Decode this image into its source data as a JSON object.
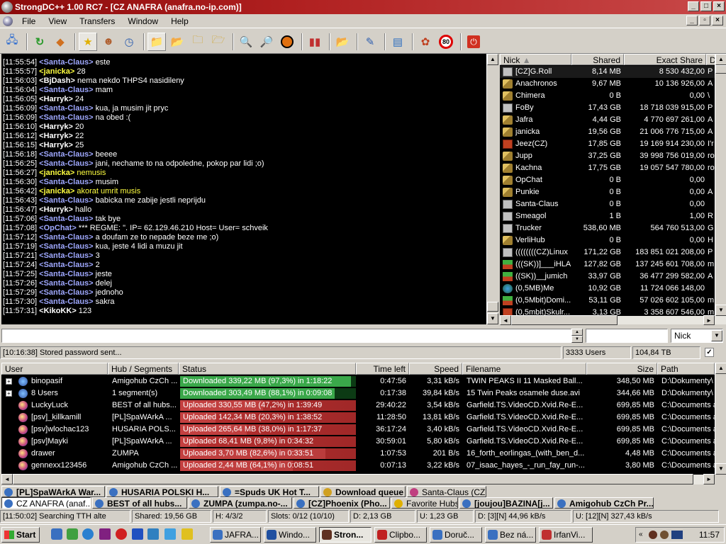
{
  "window": {
    "title": "StrongDC++ 1.00 RC7 - [CZ ANAFRA (anafra.no-ip.com)]"
  },
  "menu": [
    "File",
    "View",
    "Transfers",
    "Window",
    "Help"
  ],
  "colors": {
    "chat_bg": "#000000",
    "nick_blue": "#9fa8ff",
    "nick_white": "#ffffff",
    "nick_yellow": "#ffff40",
    "download_fill": "#3aa84a",
    "upload_fill": "#c83c3c"
  },
  "chat": [
    {
      "ts": "[11:55:54]",
      "nick": "<Santa-Claus>",
      "c": "b",
      "msg": " este"
    },
    {
      "ts": "[11:55:57]",
      "nick": "<janicka>",
      "c": "y",
      "msg": " 28"
    },
    {
      "ts": "[11:56:03]",
      "nick": "<BjDash>",
      "c": "w",
      "msg": " nema nekdo THPS4 nasidileny"
    },
    {
      "ts": "[11:56:04]",
      "nick": "<Santa-Claus>",
      "c": "b",
      "msg": " mam"
    },
    {
      "ts": "[11:56:05]",
      "nick": "<Harryk>",
      "c": "w",
      "msg": " 24"
    },
    {
      "ts": "[11:56:09]",
      "nick": "<Santa-Claus>",
      "c": "b",
      "msg": " kua, ja musim jit pryc"
    },
    {
      "ts": "[11:56:09]",
      "nick": "<Santa-Claus>",
      "c": "b",
      "msg": " na obed :("
    },
    {
      "ts": "[11:56:10]",
      "nick": "<Harryk>",
      "c": "w",
      "msg": " 20"
    },
    {
      "ts": "[11:56:12]",
      "nick": "<Harryk>",
      "c": "w",
      "msg": " 22"
    },
    {
      "ts": "[11:56:15]",
      "nick": "<Harryk>",
      "c": "w",
      "msg": " 25"
    },
    {
      "ts": "[11:56:18]",
      "nick": "<Santa-Claus>",
      "c": "b",
      "msg": " beeee"
    },
    {
      "ts": "[11:56:25]",
      "nick": "<Santa-Claus>",
      "c": "b",
      "msg": " jani, nechame to na odpoledne, pokop par lidi ;o)"
    },
    {
      "ts": "[11:56:27]",
      "nick": "<janicka>",
      "c": "y",
      "msg": " nemusis",
      "my": true
    },
    {
      "ts": "[11:56:30]",
      "nick": "<Santa-Claus>",
      "c": "b",
      "msg": " musim"
    },
    {
      "ts": "[11:56:42]",
      "nick": "<janicka>",
      "c": "y",
      "msg": " akorat umrit musis",
      "my": true
    },
    {
      "ts": "[11:56:43]",
      "nick": "<Santa-Claus>",
      "c": "b",
      "msg": " babicka me zabije jestli neprijdu"
    },
    {
      "ts": "[11:56:47]",
      "nick": "<Harryk>",
      "c": "w",
      "msg": " hallo"
    },
    {
      "ts": "[11:57:06]",
      "nick": "<Santa-Claus>",
      "c": "b",
      "msg": " tak bye"
    },
    {
      "ts": "[11:57:08]",
      "nick": "<OpChat>",
      "c": "b",
      "msg": " *** REGME: \". IP= 62.129.46.210  Host=  User= schveik"
    },
    {
      "ts": "[11:57:12]",
      "nick": "<Santa-Claus>",
      "c": "b",
      "msg": " a doufam ze to nepade beze me ;o)"
    },
    {
      "ts": "[11:57:19]",
      "nick": "<Santa-Claus>",
      "c": "b",
      "msg": " kua, jeste 4 lidi a muzu jit"
    },
    {
      "ts": "[11:57:21]",
      "nick": "<Santa-Claus>",
      "c": "b",
      "msg": " 3"
    },
    {
      "ts": "[11:57:24]",
      "nick": "<Santa-Claus>",
      "c": "b",
      "msg": " 2"
    },
    {
      "ts": "[11:57:25]",
      "nick": "<Santa-Claus>",
      "c": "b",
      "msg": " jeste"
    },
    {
      "ts": "[11:57:26]",
      "nick": "<Santa-Claus>",
      "c": "b",
      "msg": " delej"
    },
    {
      "ts": "[11:57:29]",
      "nick": "<Santa-Claus>",
      "c": "b",
      "msg": " jednoho"
    },
    {
      "ts": "[11:57:30]",
      "nick": "<Santa-Claus>",
      "c": "b",
      "msg": " sakra"
    },
    {
      "ts": "[11:57:31]",
      "nick": "<KikoKK>",
      "c": "w",
      "msg": " 123"
    }
  ],
  "nicklist": {
    "headers": [
      "Nick",
      "Shared",
      "Exact Share",
      "D"
    ],
    "rows": [
      {
        "nick": "[CZ]G.Roll",
        "shared": "8,14 MB",
        "exact": "8 530 432,00",
        "d": "P",
        "icon": "grey"
      },
      {
        "nick": "Anachronos",
        "shared": "9,67 MB",
        "exact": "10 136 926,00",
        "d": "A",
        "icon": "key"
      },
      {
        "nick": "Chimera",
        "shared": "0 B",
        "exact": "0,00",
        "d": "\\",
        "icon": "key"
      },
      {
        "nick": "FoBy",
        "shared": "17,43 GB",
        "exact": "18 718 039 915,00",
        "d": "P",
        "icon": "grey"
      },
      {
        "nick": "Jafra",
        "shared": "4,44 GB",
        "exact": "4 770 697 261,00",
        "d": "A",
        "icon": "key"
      },
      {
        "nick": "janicka",
        "shared": "19,56 GB",
        "exact": "21 006 776 715,00",
        "d": "A",
        "icon": "key"
      },
      {
        "nick": "Jeez(CZ)",
        "shared": "17,85 GB",
        "exact": "19 169 914 230,00",
        "d": "I'r",
        "icon": "red"
      },
      {
        "nick": "Jupp",
        "shared": "37,25 GB",
        "exact": "39 998 756 019,00",
        "d": "ro",
        "icon": "key"
      },
      {
        "nick": "Kachna",
        "shared": "17,75 GB",
        "exact": "19 057 547 780,00",
        "d": "ro",
        "icon": "key"
      },
      {
        "nick": "OpChat",
        "shared": "0 B",
        "exact": "0,00",
        "d": "",
        "icon": "key"
      },
      {
        "nick": "Punkie",
        "shared": "0 B",
        "exact": "0,00",
        "d": "A",
        "icon": "key"
      },
      {
        "nick": "Santa-Claus",
        "shared": "0 B",
        "exact": "0,00",
        "d": "",
        "icon": "grey"
      },
      {
        "nick": "Smeagol",
        "shared": "1 B",
        "exact": "1,00",
        "d": "R",
        "icon": "grey"
      },
      {
        "nick": "Trucker",
        "shared": "538,60 MB",
        "exact": "564 760 513,00",
        "d": "G",
        "icon": "grey"
      },
      {
        "nick": "VerliHub",
        "shared": "0 B",
        "exact": "0,00",
        "d": "H",
        "icon": "key"
      },
      {
        "nick": "((((((((CZ)Linux",
        "shared": "171,22 GB",
        "exact": "183 851 021 208,00",
        "d": "P",
        "icon": "grey"
      },
      {
        "nick": "(((SK))]___iHLA",
        "shared": "127,82 GB",
        "exact": "137 245 601 708,00",
        "d": "m",
        "icon": "green"
      },
      {
        "nick": "((SK))__jumich",
        "shared": "33,97 GB",
        "exact": "36 477 299 582,00",
        "d": "A",
        "icon": "green"
      },
      {
        "nick": "(0,5MB)Me",
        "shared": "10,92 GB",
        "exact": "11 724 066 148,00",
        "d": "",
        "icon": "globe"
      },
      {
        "nick": "(0,5Mbit)Domi...",
        "shared": "53,11 GB",
        "exact": "57 026 602 105,00",
        "d": "m",
        "icon": "green"
      },
      {
        "nick": "(0,5mbit)Skulr...",
        "shared": "3,13 GB",
        "exact": "3 358 607 546,00",
        "d": "m",
        "icon": "red"
      }
    ]
  },
  "input": {
    "message": "",
    "filter": "",
    "filter_by": "Nick"
  },
  "status1": {
    "text": "[10:16:38] Stored password sent...",
    "users": "3333 Users",
    "share": "104,84 TB"
  },
  "transfers": {
    "headers": [
      "User",
      "Hub / Segments",
      "Status",
      "Time left",
      "Speed",
      "Filename",
      "Size",
      "Path"
    ],
    "rows": [
      {
        "exp": "+",
        "user": "binopasif",
        "hub": "Amigohub CzCh ...",
        "status": "Downloaded 339,22 MB (97,3%) in 1:18:22",
        "type": "d",
        "pct": 97.3,
        "time": "0:47:56",
        "speed": "3,31 kB/s",
        "file": "TWIN PEAKS II 11 Masked Ball...",
        "size": "348,50 MB",
        "path": "D:\\Dokumenty\\"
      },
      {
        "exp": "+",
        "user": "8 Users",
        "hub": "1 segment(s)",
        "status": "Downloaded 303,49 MB (88,1%) in 0:09:08",
        "type": "d",
        "pct": 88.1,
        "time": "0:17:38",
        "speed": "39,84 kB/s",
        "file": "15 Twin Peaks osamele duse.avi",
        "size": "344,66 MB",
        "path": "D:\\Dokumenty\\"
      },
      {
        "exp": "",
        "user": "LuckyLuck",
        "hub": "BEST of all hubs...",
        "status": "Uploaded 330,55 MB (47,2%) in 1:39:49",
        "type": "u",
        "pct": 47.2,
        "time": "29:40:22",
        "speed": "3,54 kB/s",
        "file": "Garfield.TS.VideoCD.Xvid.Re-E...",
        "size": "699,85 MB",
        "path": "C:\\Documents a"
      },
      {
        "exp": "",
        "user": "[psv]_killkamill",
        "hub": "[PL]SpaWArkA ...",
        "status": "Uploaded 142,34 MB (20,3%) in 1:38:52",
        "type": "u",
        "pct": 20.3,
        "time": "11:28:50",
        "speed": "13,81 kB/s",
        "file": "Garfield.TS.VideoCD.Xvid.Re-E...",
        "size": "699,85 MB",
        "path": "C:\\Documents a"
      },
      {
        "exp": "",
        "user": "[psv]wlochac123",
        "hub": "HUSARIA POLS...",
        "status": "Uploaded 265,64 MB (38,0%) in 1:17:37",
        "type": "u",
        "pct": 38.0,
        "time": "36:17:24",
        "speed": "3,40 kB/s",
        "file": "Garfield.TS.VideoCD.Xvid.Re-E...",
        "size": "699,85 MB",
        "path": "C:\\Documents a"
      },
      {
        "exp": "",
        "user": "[psv]Mayki",
        "hub": "[PL]SpaWArkA ...",
        "status": "Uploaded 68,41 MB (9,8%) in 0:34:32",
        "type": "u",
        "pct": 9.8,
        "time": "30:59:01",
        "speed": "5,80 kB/s",
        "file": "Garfield.TS.VideoCD.Xvid.Re-E...",
        "size": "699,85 MB",
        "path": "C:\\Documents a"
      },
      {
        "exp": "",
        "user": "drawer",
        "hub": "ZUMPA",
        "status": "Uploaded 3,70 MB (82,6%) in 0:33:51",
        "type": "u",
        "pct": 82.6,
        "time": "1:07:53",
        "speed": "201 B/s",
        "file": "16_forth_eorlingas_(with_ben_d...",
        "size": "4,48 MB",
        "path": "C:\\Documents a"
      },
      {
        "exp": "",
        "user": "gennexx123456",
        "hub": "Amigohub CzCh ...",
        "status": "Uploaded 2,44 MB (64,1%) in 0:08:51",
        "type": "u",
        "pct": 64.1,
        "time": "0:07:13",
        "speed": "3,22 kB/s",
        "file": "07_isaac_hayes_-_run_fay_run-...",
        "size": "3,80 MB",
        "path": "C:\\Documents a"
      }
    ]
  },
  "tabs_row1": [
    "[PL]SpaWArkA War...",
    "HUSARIA POLSKI H...",
    "=Spuds UK Hot T...",
    "Download queue",
    "Santa-Claus (CZ ..."
  ],
  "tabs_row2": [
    "CZ ANAFRA (anaf...",
    "BEST of all hubs...",
    "ZUMPA (zumpa.no-...",
    "[CZ]Phoenix (Pho...",
    "Favorite Hubs",
    "[joujou]BAZINA[j...",
    "Amigohub CzCh Pr..."
  ],
  "status2": {
    "msg": "[11:50:02] Searching TTH alte",
    "shared": "Shared: 19,56 GB",
    "hubs": "H: 4/3/2",
    "slots": "Slots: 0/12 (10/10)",
    "d": "D: 2,13 GB",
    "u": "U: 1,23 GB",
    "drate": "D: [3][N] 44,96 kB/s",
    "urate": "U: [12][N] 327,43 kB/s"
  },
  "taskbar": {
    "start": "Start",
    "tasks": [
      "JAFRA...",
      "Windo...",
      "Stron...",
      "Clipbo...",
      "Doruč...",
      "Bez ná...",
      "IrfanVi..."
    ],
    "clock": "11:57"
  }
}
